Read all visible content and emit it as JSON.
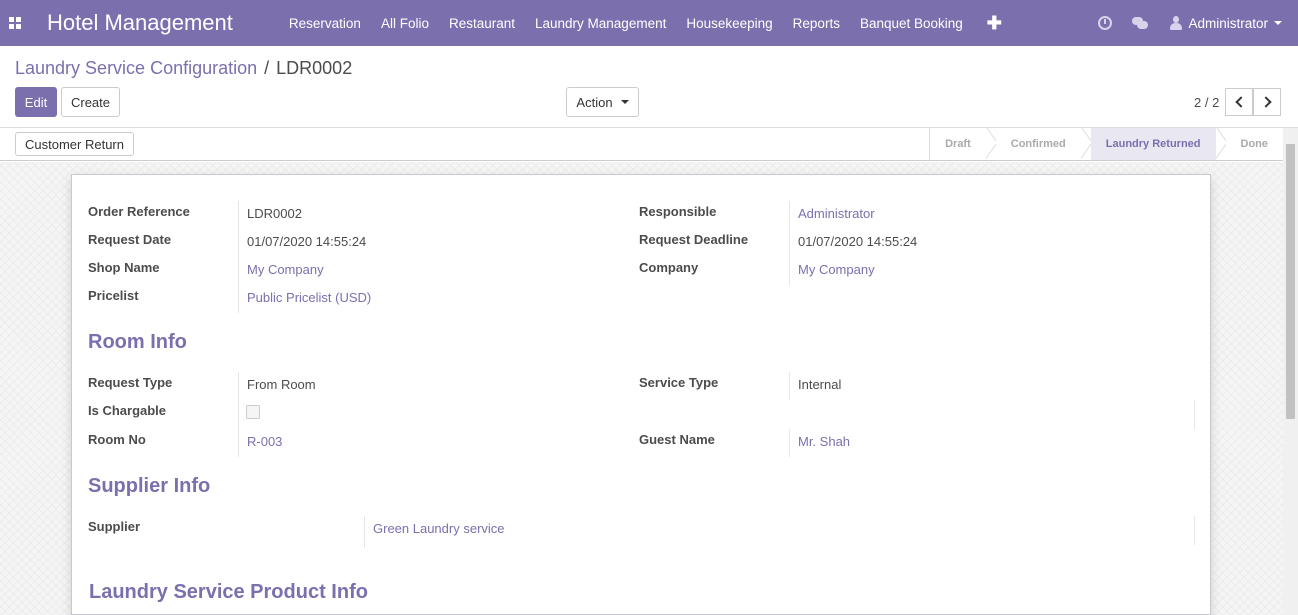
{
  "navbar": {
    "brand": "Hotel Management",
    "menu": [
      "Reservation",
      "All Folio",
      "Restaurant",
      "Laundry Management",
      "Housekeeping",
      "Reports",
      "Banquet Booking"
    ],
    "plus": "✚",
    "user": "Administrator"
  },
  "breadcrumb": {
    "parent": "Laundry Service Configuration",
    "separator": "/",
    "current": "LDR0002"
  },
  "buttons": {
    "edit": "Edit",
    "create": "Create",
    "action": "Action",
    "customer_return": "Customer Return"
  },
  "pager": {
    "value": "2 / 2"
  },
  "status": {
    "stages": [
      "Draft",
      "Confirmed",
      "Laundry Returned",
      "Done"
    ],
    "active": "Laundry Returned"
  },
  "form": {
    "order_reference": {
      "label": "Order Reference",
      "value": "LDR0002"
    },
    "request_date": {
      "label": "Request Date",
      "value": "01/07/2020 14:55:24"
    },
    "shop_name": {
      "label": "Shop Name",
      "value": "My Company"
    },
    "pricelist": {
      "label": "Pricelist",
      "value": "Public Pricelist (USD)"
    },
    "responsible": {
      "label": "Responsible",
      "value": "Administrator"
    },
    "request_deadline": {
      "label": "Request Deadline",
      "value": "01/07/2020 14:55:24"
    },
    "company": {
      "label": "Company",
      "value": "My Company"
    },
    "room_info_title": "Room Info",
    "request_type": {
      "label": "Request Type",
      "value": "From Room"
    },
    "is_chargable": {
      "label": "Is Chargable",
      "checked": false
    },
    "room_no": {
      "label": "Room No",
      "value": "R-003"
    },
    "service_type": {
      "label": "Service Type",
      "value": "Internal"
    },
    "guest_name": {
      "label": "Guest Name",
      "value": "Mr. Shah"
    },
    "supplier_info_title": "Supplier Info",
    "supplier": {
      "label": "Supplier",
      "value": "Green Laundry service"
    },
    "product_info_title": "Laundry Service Product Info"
  },
  "colors": {
    "brand": "#7c6fae",
    "active_stage_bg": "#e9e7f2"
  }
}
